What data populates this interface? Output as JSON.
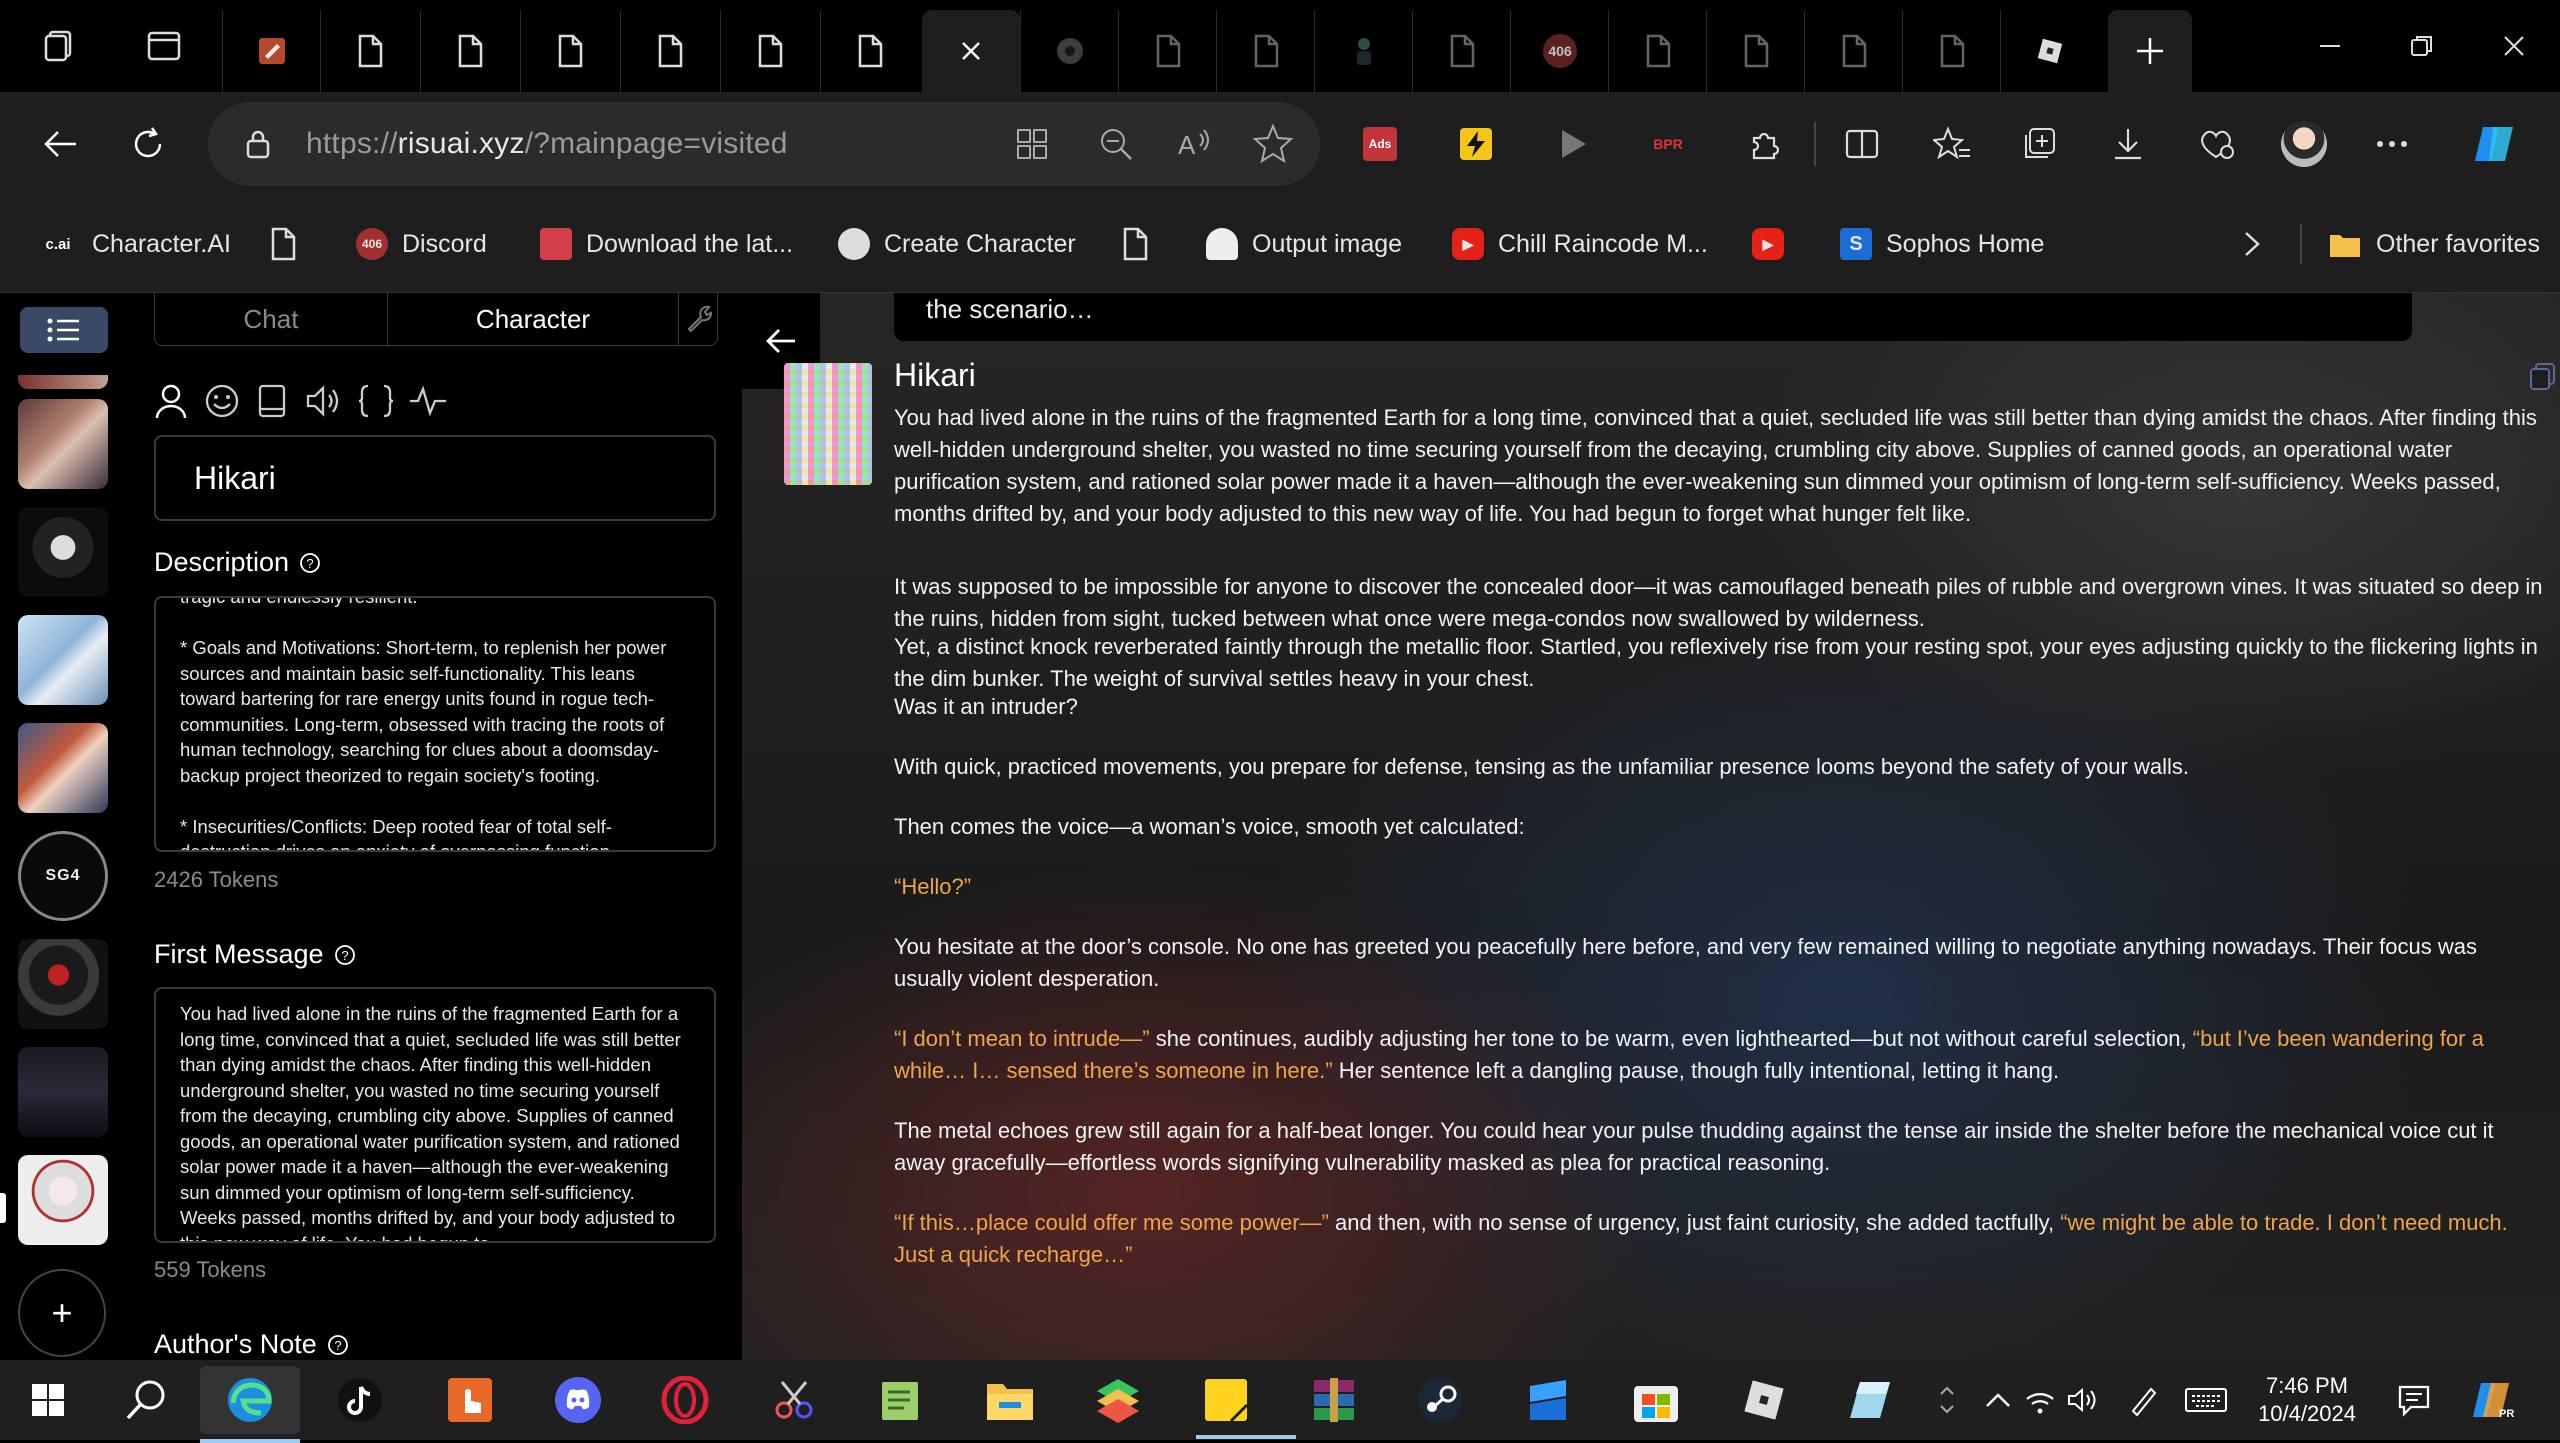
{
  "browser": {
    "url_prefix": "https://",
    "url_domain": "risuai.xyz",
    "url_path": "/?mainpage=visited",
    "tabs": [
      {
        "icon": "notepad-tab-icon"
      },
      {
        "icon": "document-tab-icon"
      },
      {
        "icon": "document-tab-icon"
      },
      {
        "icon": "document-tab-icon"
      },
      {
        "icon": "document-tab-icon"
      },
      {
        "icon": "document-tab-icon"
      },
      {
        "icon": "document-tab-icon"
      },
      {
        "icon": "close-icon"
      },
      {
        "icon": "settings-tab-icon"
      },
      {
        "icon": "document-tab-icon"
      },
      {
        "icon": "document-tab-icon"
      },
      {
        "icon": "figure-tab-icon"
      },
      {
        "icon": "document-tab-icon"
      },
      {
        "icon": "error-tab-icon",
        "badge": "406"
      },
      {
        "icon": "document-tab-icon"
      },
      {
        "icon": "document-tab-icon"
      },
      {
        "icon": "document-tab-icon"
      },
      {
        "icon": "document-tab-icon"
      },
      {
        "icon": "roblox-tab-icon"
      }
    ],
    "ext_ads_label": "Ads",
    "ext_bpr_label": "BPR"
  },
  "favorites": {
    "items": [
      {
        "label": "Character.AI",
        "icon_text": "c.ai"
      },
      {
        "label": "",
        "icon_text": ""
      },
      {
        "label": "Discord",
        "icon_text": "406"
      },
      {
        "label": "Download the lat...",
        "icon_text": ""
      },
      {
        "label": "Create Character",
        "icon_text": ""
      },
      {
        "label": "",
        "icon_text": ""
      },
      {
        "label": "Output image",
        "icon_text": ""
      },
      {
        "label": "Chill Raincode M...",
        "icon_text": ""
      },
      {
        "label": "",
        "icon_text": ""
      },
      {
        "label": "Sophos Home",
        "icon_text": "S"
      }
    ],
    "other_favorites": "Other favorites"
  },
  "rail": {
    "add_label": "+",
    "avatar_text_sg4": "SG4"
  },
  "panel": {
    "tab_chat": "Chat",
    "tab_character": "Character",
    "char_name": "Hikari",
    "description_label": "Description",
    "description_text": "tragic and endlessly resilient.\n\n* Goals and Motivations: Short-term, to replenish her power sources and maintain basic self-functionality. This leans toward bartering for rare energy units found in rogue tech-communities. Long-term, obsessed with tracing the roots of human technology, searching for clues about a doomsday-backup project theorized to regain society's footing.\n\n* Insecurities/Conflicts: Deep rooted fear of total self-destruction drives an anxiety of overpassing function",
    "description_tokens": "2426 Tokens",
    "first_message_label": "First Message",
    "first_message_text": "You had lived alone in the ruins of the fragmented Earth for a long time, convinced that a quiet, secluded life was still better than dying amidst the chaos. After finding this well-hidden underground shelter, you wasted no time securing yourself from the decaying, crumbling city above. Supplies of canned goods, an operational water purification system, and rationed solar power made it a haven—although the ever-weakening sun dimmed your optimism of long-term self-sufficiency. Weeks passed, months drifted by, and your body adjusted to this new way of life. You had begun to",
    "first_message_tokens": "559 Tokens",
    "authors_note_label": "Author's Note"
  },
  "chat": {
    "prev_text": "the scenario…",
    "name": "Hikari",
    "p1": "You had lived alone in the ruins of the fragmented Earth for a long time, convinced that a quiet, secluded life was still better than dying amidst the chaos. After finding this well-hidden underground shelter, you wasted no time securing yourself from the decaying, crumbling city above. Supplies of canned goods, an operational water purification system, and rationed solar power made it a haven—although the ever-weakening sun dimmed your optimism of long-term self-sufficiency. Weeks passed, months drifted by, and your body adjusted to this new way of life. You had begun to forget what hunger felt like.",
    "p2": "It was supposed to be impossible for anyone to discover the concealed door—it was camouflaged beneath piles of rubble and overgrown vines. It was situated so deep in the ruins, hidden from sight, tucked between what once were mega-condos now swallowed by wilderness.",
    "p3": "Yet, a distinct knock reverberated faintly through the metallic floor. Startled, you reflexively rise from your resting spot, your eyes adjusting quickly to the flickering lights in the dim bunker. The weight of survival settles heavy in your chest.",
    "p4": "Was it an intruder?",
    "p5": "With quick, practiced movements, you prepare for defense, tensing as the unfamiliar presence looms beyond the safety of your walls.",
    "p6": "Then comes the voice—a woman’s voice, smooth yet calculated:",
    "p7": "“Hello?”",
    "p8": "You hesitate at the door’s console. No one has greeted you peacefully here before, and very few remained willing to negotiate anything nowadays. Their focus was usually violent desperation.",
    "p9_q1": "“I don’t mean to intrude—”",
    "p9_t1": " she continues, audibly adjusting her tone to be warm, even lighthearted—but not without careful selection, ",
    "p9_q2": "“but I’ve been wandering for a while… I… sensed there’s someone in here.”",
    "p9_t2": " Her sentence left a dangling pause, though fully intentional, letting it hang.",
    "p10": "The metal echoes grew still again for a half-beat longer. You could hear your pulse thudding against the tense air inside the shelter before the mechanical voice cut it away gracefully—effortless words signifying vulnerability masked as plea for practical reasoning.",
    "p11_q1": "“If this…place could offer me some power—”",
    "p11_t1": " and then, with no sense of urgency, just faint curiosity, she added tactfully, ",
    "p11_q2": "“we might be able to trade. I don’t need much. Just a quick recharge…”"
  },
  "taskbar": {
    "time": "7:46 PM",
    "date": "10/4/2024"
  },
  "colors": {
    "accent_quote": "#f0a44a",
    "rail_active": "#3a4a66"
  }
}
